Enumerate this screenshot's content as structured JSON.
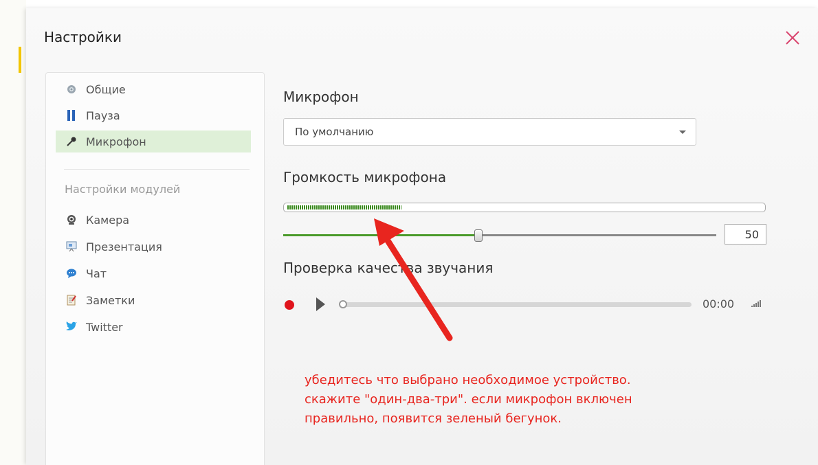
{
  "dialog": {
    "title": "Настройки",
    "close_icon": "close-icon"
  },
  "sidebar": {
    "items": [
      {
        "label": "Общие",
        "icon": "gear-icon"
      },
      {
        "label": "Пауза",
        "icon": "pause-icon"
      },
      {
        "label": "Микрофон",
        "icon": "microphone-icon",
        "active": true
      }
    ],
    "section_label": "Настройки модулей",
    "modules": [
      {
        "label": "Камера",
        "icon": "webcam-icon"
      },
      {
        "label": "Презентация",
        "icon": "presentation-icon"
      },
      {
        "label": "Чат",
        "icon": "chat-bubble-icon"
      },
      {
        "label": "Заметки",
        "icon": "notes-icon"
      },
      {
        "label": "Twitter",
        "icon": "twitter-bird-icon"
      }
    ]
  },
  "main": {
    "microphone_heading": "Микрофон",
    "device_select": {
      "selected": "По умолчанию"
    },
    "volume_heading": "Громкость микрофона",
    "input_level_fraction": 0.24,
    "volume_value": "50",
    "volume_fraction": 0.45,
    "quality_heading": "Проверка качества звучания",
    "player": {
      "time": "00:00",
      "progress_fraction": 0.0
    }
  },
  "annotation": {
    "lines": [
      "убедитесь что выбрано необходимое устройство.",
      "скажите \"один-два-три\". если микрофон включен",
      "правильно, появится зеленый бегунок."
    ]
  },
  "colors": {
    "accent_green": "#4a9a2a",
    "active_bg": "#dff0d8",
    "annotation_red": "#e8251f",
    "close_pink": "#d9466f",
    "record_red": "#e0141c"
  }
}
